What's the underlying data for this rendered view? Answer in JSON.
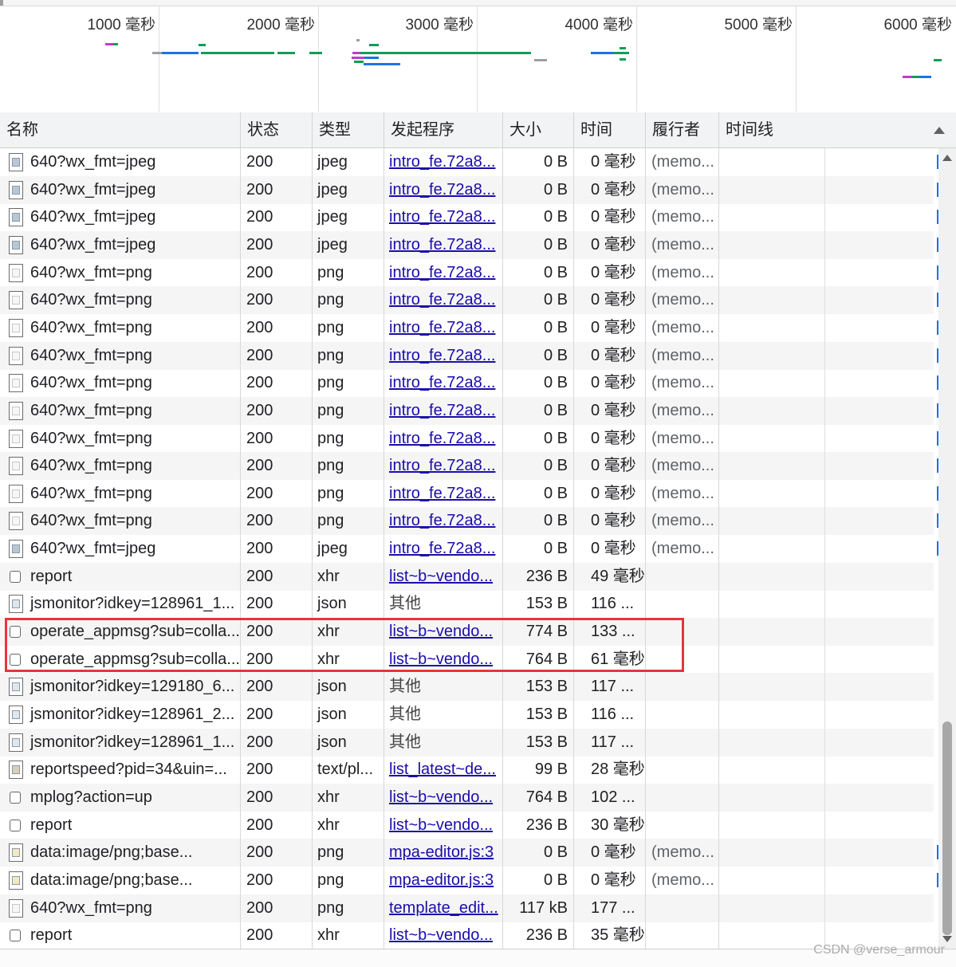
{
  "overview": {
    "tick_labels": [
      "1000 毫秒",
      "2000 毫秒",
      "3000 毫秒",
      "4000 毫秒",
      "5000 毫秒",
      "6000 毫秒"
    ],
    "colors": {
      "waiting": "#0f9d58",
      "download": "#1a73e8",
      "script": "#c03cc8",
      "neutral": "#9aa0a6"
    }
  },
  "columns": {
    "name": "名称",
    "status": "状态",
    "type": "类型",
    "initiator": "发起程序",
    "size": "大小",
    "time": "时间",
    "fulfilled": "履行者",
    "waterfall": "时间线"
  },
  "rows": [
    {
      "name": "640?wx_fmt=jpeg",
      "status": "200",
      "type": "jpeg",
      "initiator": "intro_fe.72a8...",
      "initiator_link": true,
      "size": "0 B",
      "time": "0 毫秒",
      "fulfilled": "(memo...",
      "icon": "image-file-icon"
    },
    {
      "name": "640?wx_fmt=jpeg",
      "status": "200",
      "type": "jpeg",
      "initiator": "intro_fe.72a8...",
      "initiator_link": true,
      "size": "0 B",
      "time": "0 毫秒",
      "fulfilled": "(memo...",
      "icon": "image-file-icon"
    },
    {
      "name": "640?wx_fmt=jpeg",
      "status": "200",
      "type": "jpeg",
      "initiator": "intro_fe.72a8...",
      "initiator_link": true,
      "size": "0 B",
      "time": "0 毫秒",
      "fulfilled": "(memo...",
      "icon": "image-file-icon"
    },
    {
      "name": "640?wx_fmt=jpeg",
      "status": "200",
      "type": "jpeg",
      "initiator": "intro_fe.72a8...",
      "initiator_link": true,
      "size": "0 B",
      "time": "0 毫秒",
      "fulfilled": "(memo...",
      "icon": "image-file-icon"
    },
    {
      "name": "640?wx_fmt=png",
      "status": "200",
      "type": "png",
      "initiator": "intro_fe.72a8...",
      "initiator_link": true,
      "size": "0 B",
      "time": "0 毫秒",
      "fulfilled": "(memo...",
      "icon": "png-file-icon"
    },
    {
      "name": "640?wx_fmt=png",
      "status": "200",
      "type": "png",
      "initiator": "intro_fe.72a8...",
      "initiator_link": true,
      "size": "0 B",
      "time": "0 毫秒",
      "fulfilled": "(memo...",
      "icon": "png-file-icon"
    },
    {
      "name": "640?wx_fmt=png",
      "status": "200",
      "type": "png",
      "initiator": "intro_fe.72a8...",
      "initiator_link": true,
      "size": "0 B",
      "time": "0 毫秒",
      "fulfilled": "(memo...",
      "icon": "png-file-icon"
    },
    {
      "name": "640?wx_fmt=png",
      "status": "200",
      "type": "png",
      "initiator": "intro_fe.72a8...",
      "initiator_link": true,
      "size": "0 B",
      "time": "0 毫秒",
      "fulfilled": "(memo...",
      "icon": "png-file-icon"
    },
    {
      "name": "640?wx_fmt=png",
      "status": "200",
      "type": "png",
      "initiator": "intro_fe.72a8...",
      "initiator_link": true,
      "size": "0 B",
      "time": "0 毫秒",
      "fulfilled": "(memo...",
      "icon": "png-file-icon"
    },
    {
      "name": "640?wx_fmt=png",
      "status": "200",
      "type": "png",
      "initiator": "intro_fe.72a8...",
      "initiator_link": true,
      "size": "0 B",
      "time": "0 毫秒",
      "fulfilled": "(memo...",
      "icon": "png-file-icon"
    },
    {
      "name": "640?wx_fmt=png",
      "status": "200",
      "type": "png",
      "initiator": "intro_fe.72a8...",
      "initiator_link": true,
      "size": "0 B",
      "time": "0 毫秒",
      "fulfilled": "(memo...",
      "icon": "png-file-icon"
    },
    {
      "name": "640?wx_fmt=png",
      "status": "200",
      "type": "png",
      "initiator": "intro_fe.72a8...",
      "initiator_link": true,
      "size": "0 B",
      "time": "0 毫秒",
      "fulfilled": "(memo...",
      "icon": "png-file-icon"
    },
    {
      "name": "640?wx_fmt=png",
      "status": "200",
      "type": "png",
      "initiator": "intro_fe.72a8...",
      "initiator_link": true,
      "size": "0 B",
      "time": "0 毫秒",
      "fulfilled": "(memo...",
      "icon": "png-file-icon"
    },
    {
      "name": "640?wx_fmt=png",
      "status": "200",
      "type": "png",
      "initiator": "intro_fe.72a8...",
      "initiator_link": true,
      "size": "0 B",
      "time": "0 毫秒",
      "fulfilled": "(memo...",
      "icon": "png-file-icon"
    },
    {
      "name": "640?wx_fmt=jpeg",
      "status": "200",
      "type": "jpeg",
      "initiator": "intro_fe.72a8...",
      "initiator_link": true,
      "size": "0 B",
      "time": "0 毫秒",
      "fulfilled": "(memo...",
      "icon": "image-file-icon"
    },
    {
      "name": "report",
      "status": "200",
      "type": "xhr",
      "initiator": "list~b~vendo...",
      "initiator_link": true,
      "size": "236 B",
      "time": "49 毫秒",
      "fulfilled": "",
      "icon": "xhr-icon"
    },
    {
      "name": "jsmonitor?idkey=128961_1...",
      "status": "200",
      "type": "json",
      "initiator": "其他",
      "initiator_link": false,
      "size": "153 B",
      "time": "116 ...",
      "fulfilled": "",
      "icon": "json-file-icon"
    },
    {
      "name": "operate_appmsg?sub=colla...",
      "status": "200",
      "type": "xhr",
      "initiator": "list~b~vendo...",
      "initiator_link": true,
      "size": "774 B",
      "time": "133 ...",
      "fulfilled": "",
      "icon": "xhr-icon"
    },
    {
      "name": "operate_appmsg?sub=colla...",
      "status": "200",
      "type": "xhr",
      "initiator": "list~b~vendo...",
      "initiator_link": true,
      "size": "764 B",
      "time": "61 毫秒",
      "fulfilled": "",
      "icon": "xhr-icon"
    },
    {
      "name": "jsmonitor?idkey=129180_6...",
      "status": "200",
      "type": "json",
      "initiator": "其他",
      "initiator_link": false,
      "size": "153 B",
      "time": "117 ...",
      "fulfilled": "",
      "icon": "json-file-icon"
    },
    {
      "name": "jsmonitor?idkey=128961_2...",
      "status": "200",
      "type": "json",
      "initiator": "其他",
      "initiator_link": false,
      "size": "153 B",
      "time": "116 ...",
      "fulfilled": "",
      "icon": "json-file-icon"
    },
    {
      "name": "jsmonitor?idkey=128961_1...",
      "status": "200",
      "type": "json",
      "initiator": "其他",
      "initiator_link": false,
      "size": "153 B",
      "time": "117 ...",
      "fulfilled": "",
      "icon": "json-file-icon"
    },
    {
      "name": "reportspeed?pid=34&uin=...",
      "status": "200",
      "type": "text/pl...",
      "initiator": "list_latest~de...",
      "initiator_link": true,
      "size": "99 B",
      "time": "28 毫秒",
      "fulfilled": "",
      "icon": "text-file-icon"
    },
    {
      "name": "mplog?action=up",
      "status": "200",
      "type": "xhr",
      "initiator": "list~b~vendo...",
      "initiator_link": true,
      "size": "764 B",
      "time": "102 ...",
      "fulfilled": "",
      "icon": "xhr-icon"
    },
    {
      "name": "report",
      "status": "200",
      "type": "xhr",
      "initiator": "list~b~vendo...",
      "initiator_link": true,
      "size": "236 B",
      "time": "30 毫秒",
      "fulfilled": "",
      "icon": "xhr-icon"
    },
    {
      "name": "data:image/png;base...",
      "status": "200",
      "type": "png",
      "initiator": "mpa-editor.js:3",
      "initiator_link": true,
      "size": "0 B",
      "time": "0 毫秒",
      "fulfilled": "(memo...",
      "icon": "data-image-icon"
    },
    {
      "name": "data:image/png;base...",
      "status": "200",
      "type": "png",
      "initiator": "mpa-editor.js:3",
      "initiator_link": true,
      "size": "0 B",
      "time": "0 毫秒",
      "fulfilled": "(memo...",
      "icon": "data-image-icon"
    },
    {
      "name": "640?wx_fmt=png",
      "status": "200",
      "type": "png",
      "initiator": "template_edit...",
      "initiator_link": true,
      "size": "117 kB",
      "time": "177 ...",
      "fulfilled": "",
      "icon": "png-file-icon"
    },
    {
      "name": "report",
      "status": "200",
      "type": "xhr",
      "initiator": "list~b~vendo...",
      "initiator_link": true,
      "size": "236 B",
      "time": "35 毫秒",
      "fulfilled": "",
      "icon": "xhr-icon"
    }
  ],
  "watermark": "CSDN @verse_armour"
}
